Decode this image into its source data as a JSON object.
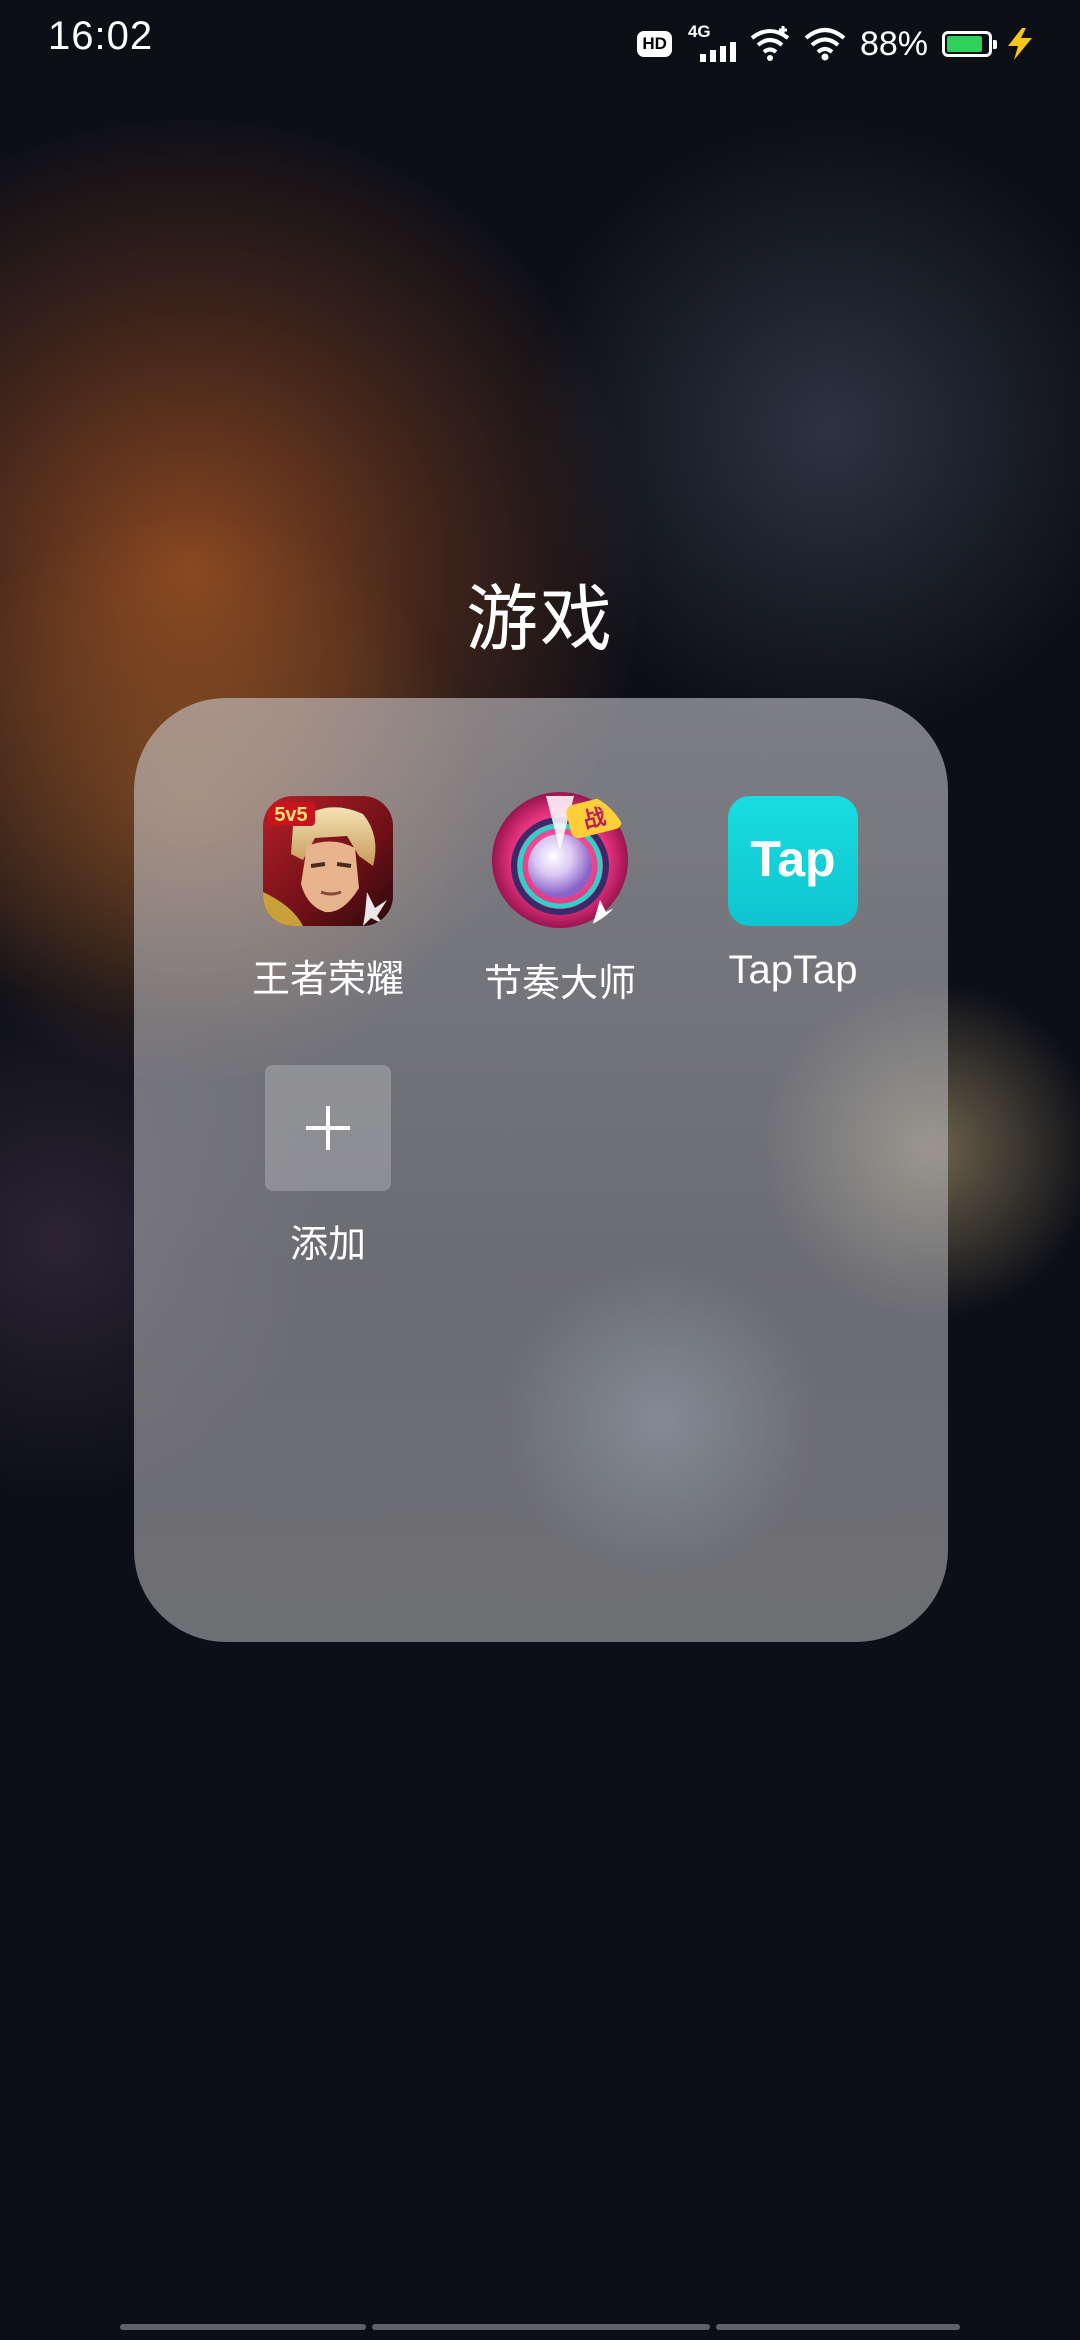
{
  "status_bar": {
    "time": "16:02",
    "hd_badge": "HD",
    "network_type": "4G",
    "battery_percent": "88%",
    "battery_level": 0.88,
    "battery_color": "#2fd158",
    "icons": [
      "hd-icon",
      "cellular-signal-icon",
      "wifi-calling-icon",
      "wifi-icon",
      "battery-icon",
      "charging-bolt-icon"
    ]
  },
  "folder": {
    "title": "游戏",
    "apps": [
      {
        "label": "王者荣耀",
        "icon": "honor-of-kings-icon"
      },
      {
        "label": "节奏大师",
        "icon": "rhythm-master-icon"
      },
      {
        "label": "TapTap",
        "icon": "taptap-icon"
      }
    ],
    "add": {
      "label": "添加",
      "icon": "plus-icon"
    }
  },
  "colors": {
    "taptap_brand": "#14d0d8",
    "rhythm_pink": "#e6347f"
  }
}
